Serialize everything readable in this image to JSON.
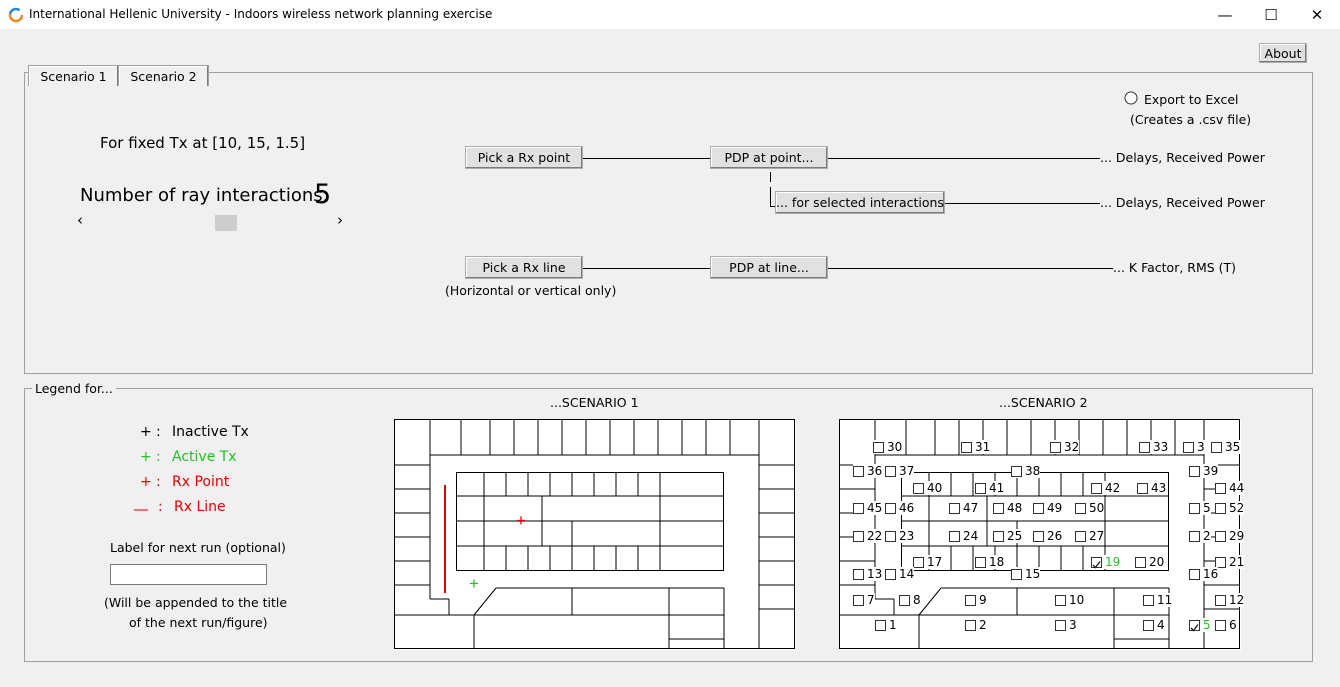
{
  "window": {
    "title": "International Hellenic University - Indoors wireless network planning exercise",
    "controls": {
      "minimize": "—",
      "maximize": "☐",
      "close": "✕"
    }
  },
  "about_label": "About",
  "tabs": [
    {
      "label": "Scenario 1"
    },
    {
      "label": "Scenario 2"
    }
  ],
  "export": {
    "label": "Export to Excel",
    "note": "(Creates a .csv file)",
    "checked": false
  },
  "fixed_tx": "For fixed Tx at [10, 15, 1.5]",
  "ray": {
    "label": "Number of ray interactions:",
    "value": "5",
    "slider_left": "‹",
    "slider_right": "›",
    "min": 0,
    "max": 10,
    "current": 5
  },
  "buttons": {
    "pick_point": "Pick a Rx point",
    "pdp_point": "PDP at point...",
    "selected_interactions": "... for selected interactions",
    "pick_line": "Pick a Rx line",
    "pdp_line": "PDP at line..."
  },
  "outputs": {
    "point": "... Delays, Received Power",
    "selected": "... Delays, Received Power",
    "line": "... K Factor, RMS (T)"
  },
  "line_note": "(Horizontal or vertical only)",
  "legend": {
    "title": "Legend for...",
    "items": [
      {
        "symbol": "+",
        "sep": ":",
        "text": "Inactive Tx",
        "color": "#000000"
      },
      {
        "symbol": "+",
        "sep": ":",
        "text": "Active Tx",
        "color": "#00b000"
      },
      {
        "symbol": "+",
        "sep": ":",
        "text": "Rx Point",
        "color": "#e00000"
      },
      {
        "symbol": "__",
        "sep": ":",
        "text": "Rx Line",
        "color": "#e00000"
      }
    ],
    "label_title": "Label for next run (optional)",
    "label_value": "",
    "label_note1": "(Will be appended to the title",
    "label_note2": "of the next run/figure)"
  },
  "scenario1": {
    "title": "...SCENARIO 1",
    "active_tx": "+",
    "rx_point": "+"
  },
  "scenario2": {
    "title": "...SCENARIO 2",
    "points": [
      {
        "n": "30",
        "checked": false,
        "active": false
      },
      {
        "n": "31",
        "checked": false,
        "active": false
      },
      {
        "n": "32",
        "checked": false,
        "active": false
      },
      {
        "n": "33",
        "checked": false,
        "active": false
      },
      {
        "n": "3",
        "checked": false,
        "active": false
      },
      {
        "n": "35",
        "checked": false,
        "active": false
      },
      {
        "n": "36",
        "checked": false,
        "active": false
      },
      {
        "n": "37",
        "checked": false,
        "active": false
      },
      {
        "n": "38",
        "checked": false,
        "active": false
      },
      {
        "n": "39",
        "checked": false,
        "active": false
      },
      {
        "n": "40",
        "checked": false,
        "active": false
      },
      {
        "n": "41",
        "checked": false,
        "active": false
      },
      {
        "n": "42",
        "checked": false,
        "active": false
      },
      {
        "n": "43",
        "checked": false,
        "active": false
      },
      {
        "n": "44",
        "checked": false,
        "active": false
      },
      {
        "n": "45",
        "checked": false,
        "active": false
      },
      {
        "n": "46",
        "checked": false,
        "active": false
      },
      {
        "n": "47",
        "checked": false,
        "active": false
      },
      {
        "n": "48",
        "checked": false,
        "active": false
      },
      {
        "n": "49",
        "checked": false,
        "active": false
      },
      {
        "n": "50",
        "checked": false,
        "active": false
      },
      {
        "n": "5",
        "checked": false,
        "active": false
      },
      {
        "n": "52",
        "checked": false,
        "active": false
      },
      {
        "n": "22",
        "checked": false,
        "active": false
      },
      {
        "n": "23",
        "checked": false,
        "active": false
      },
      {
        "n": "24",
        "checked": false,
        "active": false
      },
      {
        "n": "25",
        "checked": false,
        "active": false
      },
      {
        "n": "26",
        "checked": false,
        "active": false
      },
      {
        "n": "27",
        "checked": false,
        "active": false
      },
      {
        "n": "2",
        "checked": false,
        "active": false
      },
      {
        "n": "29",
        "checked": false,
        "active": false
      },
      {
        "n": "17",
        "checked": false,
        "active": false
      },
      {
        "n": "18",
        "checked": false,
        "active": false
      },
      {
        "n": "19",
        "checked": true,
        "active": true
      },
      {
        "n": "20",
        "checked": false,
        "active": false
      },
      {
        "n": "21",
        "checked": false,
        "active": false
      },
      {
        "n": "13",
        "checked": false,
        "active": false
      },
      {
        "n": "14",
        "checked": false,
        "active": false
      },
      {
        "n": "15",
        "checked": false,
        "active": false
      },
      {
        "n": "16",
        "checked": false,
        "active": false
      },
      {
        "n": "7",
        "checked": false,
        "active": false
      },
      {
        "n": "8",
        "checked": false,
        "active": false
      },
      {
        "n": "9",
        "checked": false,
        "active": false
      },
      {
        "n": "10",
        "checked": false,
        "active": false
      },
      {
        "n": "11",
        "checked": false,
        "active": false
      },
      {
        "n": "12",
        "checked": false,
        "active": false
      },
      {
        "n": "1",
        "checked": false,
        "active": false
      },
      {
        "n": "2",
        "checked": false,
        "active": false
      },
      {
        "n": "3",
        "checked": false,
        "active": false
      },
      {
        "n": "4",
        "checked": false,
        "active": false
      },
      {
        "n": "5",
        "checked": true,
        "active": true
      },
      {
        "n": "6",
        "checked": false,
        "active": false
      }
    ]
  },
  "colors": {
    "active": "#22c022",
    "rx": "#e00000",
    "brand_icon_a": "#f08a24",
    "brand_icon_b": "#1e88e5"
  },
  "icons": {
    "app": "app-logo-icon",
    "radio": "radio-icon"
  }
}
